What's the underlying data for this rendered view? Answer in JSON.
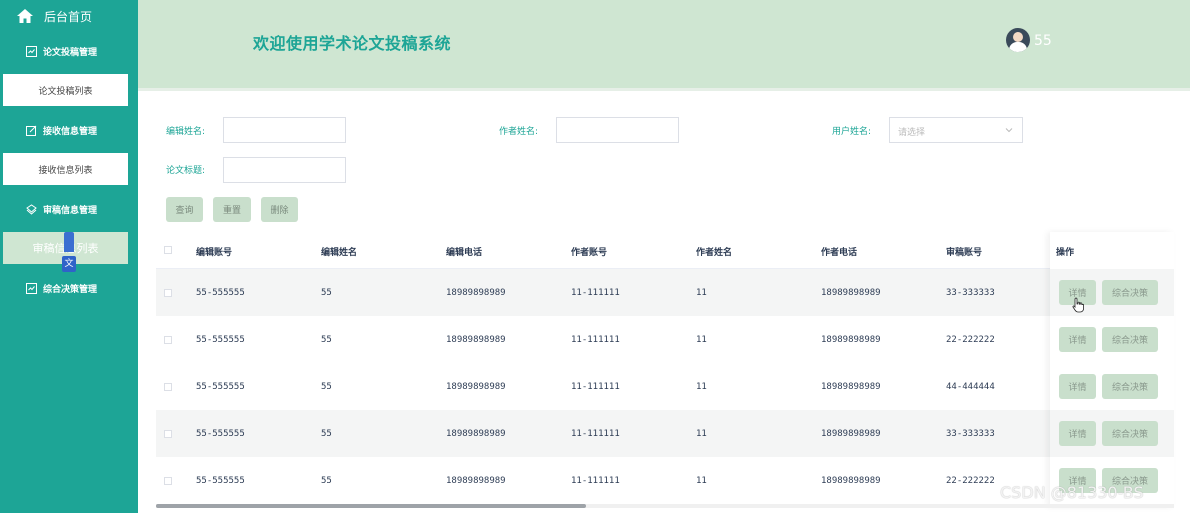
{
  "sidebar": {
    "home_label": "后台首页",
    "groups": [
      {
        "label": "论文投稿管理",
        "icon": "grid-icon",
        "sub": "论文投稿列表"
      },
      {
        "label": "接收信息管理",
        "icon": "edit-icon",
        "sub": "接收信息列表"
      },
      {
        "label": "审稿信息管理",
        "icon": "clipboard-icon",
        "sub": "审稿信息列表"
      },
      {
        "label": "综合决策管理",
        "icon": "grid-icon"
      }
    ]
  },
  "header": {
    "title": "欢迎使用学术论文投稿系统",
    "username": "55"
  },
  "search": {
    "editor_name_label": "编辑姓名:",
    "author_name_label": "作者姓名:",
    "user_name_label": "用户姓名:",
    "user_name_placeholder": "请选择",
    "paper_title_label": "论文标题:",
    "query_btn": "查询",
    "reset_btn": "重置",
    "delete_btn": "删除"
  },
  "table": {
    "headers": [
      "编辑账号",
      "编辑姓名",
      "编辑电话",
      "作者账号",
      "作者姓名",
      "作者电话",
      "审稿账号",
      "操作"
    ],
    "rows": [
      [
        "55-555555",
        "55",
        "18989898989",
        "11-111111",
        "11",
        "18989898989",
        "33-333333"
      ],
      [
        "55-555555",
        "55",
        "18989898989",
        "11-111111",
        "11",
        "18989898989",
        "22-222222"
      ],
      [
        "55-555555",
        "55",
        "18989898989",
        "11-111111",
        "11",
        "18989898989",
        "44-444444"
      ],
      [
        "55-555555",
        "55",
        "18989898989",
        "11-111111",
        "11",
        "18989898989",
        "33-333333"
      ],
      [
        "55-555555",
        "55",
        "18989898989",
        "11-111111",
        "11",
        "18989898989",
        "22-222222"
      ]
    ],
    "detail_btn": "详情",
    "decision_btn": "综合决策"
  },
  "watermark": "CSDN @81330-BS",
  "colors": {
    "sidebar": "#1da596",
    "header": "#cfe6d2",
    "button": "#c9dfcc",
    "title": "#1da596"
  }
}
